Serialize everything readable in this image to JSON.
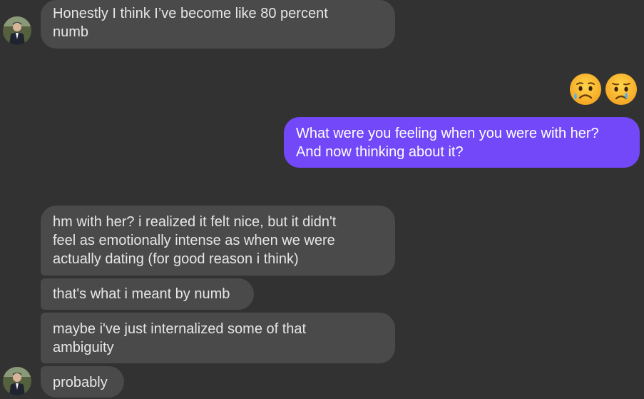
{
  "conversation": {
    "messages": [
      {
        "sender": "other",
        "lines": [
          "Honestly I think I’ve become like 80 percent",
          "numb"
        ]
      },
      {
        "sender": "me",
        "reaction_emoji": [
          "disappointed-but-relieved-face",
          "crying-face"
        ]
      },
      {
        "sender": "me",
        "lines": [
          "What were you feeling when you were with her?",
          "And now thinking about it?"
        ]
      },
      {
        "sender": "other",
        "lines": [
          "hm with her? i realized it felt nice, but it didn't",
          "feel as emotionally intense as when we were",
          "actually dating (for good reason i think)"
        ]
      },
      {
        "sender": "other",
        "lines": [
          "that's what i meant by numb"
        ]
      },
      {
        "sender": "other",
        "lines": [
          "maybe i've just internalized some of that",
          "ambiguity"
        ]
      },
      {
        "sender": "other",
        "lines": [
          "probably"
        ]
      }
    ]
  },
  "colors": {
    "background": "#323232",
    "incoming_bubble": "#4a4a4a",
    "outgoing_bubble": "#7248f8",
    "incoming_text": "#e6e6e6",
    "outgoing_text": "#ffffff"
  }
}
